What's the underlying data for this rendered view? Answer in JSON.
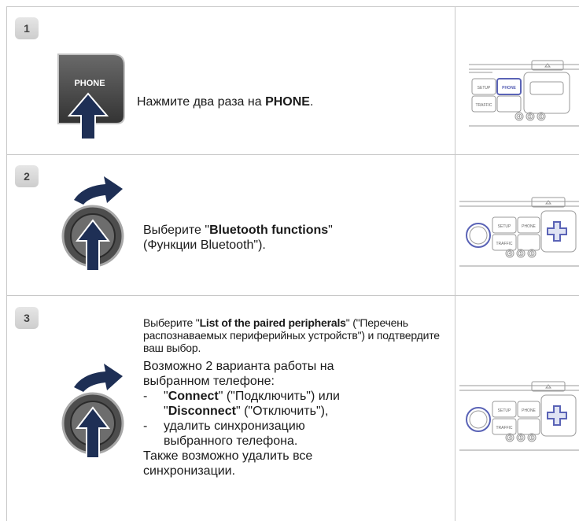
{
  "steps": [
    {
      "number": "1",
      "icon_label": "PHONE",
      "text_prefix": "Нажмите два раза на ",
      "text_bold": "PHONE",
      "text_suffix": "."
    },
    {
      "number": "2",
      "text_prefix": "Выберите \"",
      "text_bold": "Bluetooth functions",
      "text_suffix": "\"",
      "text_line2": "(Функции Bluetooth\")."
    },
    {
      "number": "3",
      "cond_prefix": "Выберите \"",
      "cond_bold": "List of the paired peripherals",
      "cond_suffix": "\"",
      "cond_rest": "(\"Перечень распознаваемых периферийных устройств\") и подтвердите ваш выбор.",
      "intro": "Возможно 2 варианта работы на выбранном телефоне:",
      "options": [
        {
          "dash": "-",
          "q1": "\"",
          "bold1": "Connect",
          "mid1": "\" (\"Подключить\") или",
          "q2": "\"",
          "bold2": "Disconnect",
          "mid2": "\" (\"Отключить\"),"
        },
        {
          "dash": "-",
          "text": "удалить синхронизацию выбранного телефона."
        }
      ],
      "closing": "Также возможно удалить все синхронизации."
    }
  ],
  "panel_labels": {
    "setup": "SETUP",
    "phone": "PHONE",
    "traffic": "TRAFFIC",
    "btn4": "4",
    "btn5": "5",
    "btn6": "6"
  },
  "colors": {
    "arrow": "#1e2f55",
    "highlight": "#5a63b6",
    "border": "#c8c8c8"
  }
}
